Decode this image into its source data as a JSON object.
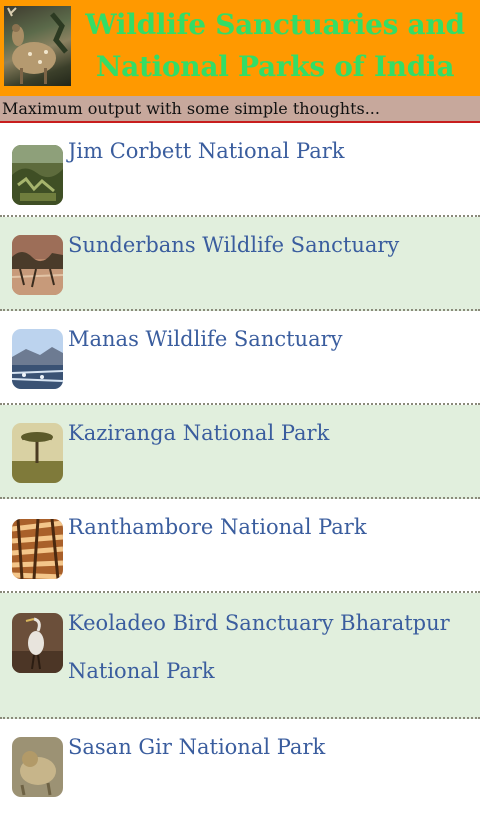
{
  "header": {
    "title": "Wildlife Sanctuaries and National Parks of India",
    "logo_icon": "deer-logo-icon",
    "bg_color": "#ff9900",
    "title_color": "#33dd66"
  },
  "subtitle": {
    "text": "Maximum output with some simple thoughts..."
  },
  "items": [
    {
      "label": "Jim Corbett National Park",
      "icon": "forest-thumbnail"
    },
    {
      "label": "Sunderbans Wildlife Sanctuary",
      "icon": "mangrove-thumbnail"
    },
    {
      "label": "Manas Wildlife Sanctuary",
      "icon": "river-thumbnail"
    },
    {
      "label": "Kaziranga National Park",
      "icon": "tree-grassland-thumbnail"
    },
    {
      "label": "Ranthambore National Park",
      "icon": "tiger-thumbnail"
    },
    {
      "label": "Keoladeo Bird Sanctuary Bharatpur National Park",
      "icon": "heron-thumbnail"
    },
    {
      "label": "Sasan Gir National Park",
      "icon": "lion-thumbnail"
    }
  ]
}
